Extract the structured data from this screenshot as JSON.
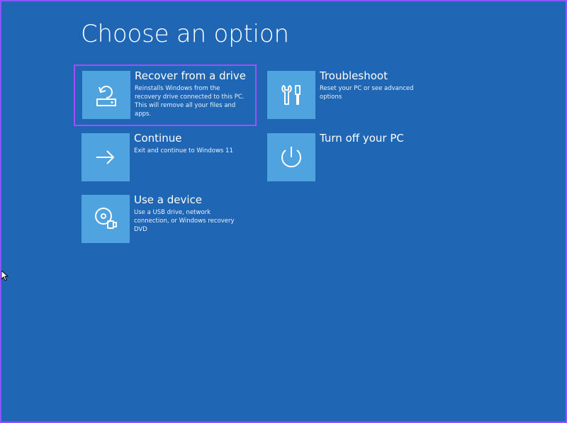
{
  "window": {
    "title": "Choose an option"
  },
  "options": [
    {
      "key": "recover",
      "label": "Recover from a drive",
      "description": "Reinstalls Windows from the recovery drive connected to this PC. This will remove all your files and apps.",
      "icon": "recover-drive-icon",
      "selected": true
    },
    {
      "key": "troubleshoot",
      "label": "Troubleshoot",
      "description": "Reset your PC or see advanced options",
      "icon": "troubleshoot-tools-icon",
      "selected": false
    },
    {
      "key": "continue",
      "label": "Continue",
      "description": "Exit and continue to Windows 11",
      "icon": "arrow-right-icon",
      "selected": false
    },
    {
      "key": "turn-off",
      "label": "Turn off your PC",
      "description": "",
      "icon": "power-icon",
      "selected": false
    },
    {
      "key": "use-device",
      "label": "Use a device",
      "description": "Use a USB drive, network connection, or Windows recovery DVD",
      "icon": "device-usb-disc-icon",
      "selected": false
    }
  ],
  "colors": {
    "background": "#1f66b4",
    "tile": "#4fa3df",
    "selection_outline": "#a64cff",
    "text": "#ffffff"
  }
}
